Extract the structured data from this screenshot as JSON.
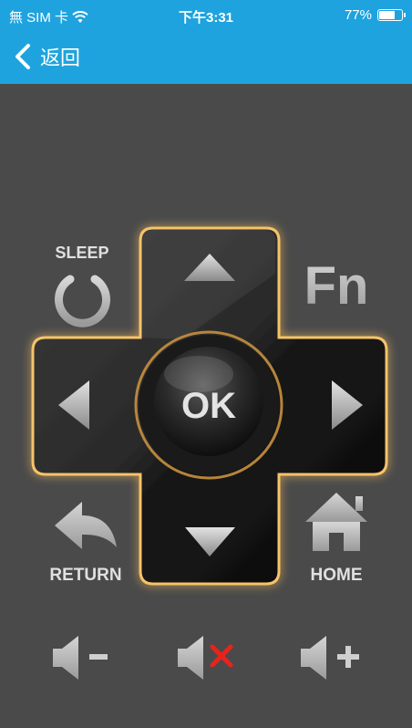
{
  "status_bar": {
    "carrier": "無 SIM 卡",
    "time": "下午3:31",
    "battery_text": "77%",
    "battery_level": 0.77
  },
  "nav": {
    "back_label": "返回"
  },
  "remote": {
    "sleep_label": "SLEEP",
    "fn_label": "Fn",
    "ok_label": "OK",
    "return_label": "RETURN",
    "home_label": "HOME"
  },
  "colors": {
    "nav_bar": "#1ea3de",
    "background": "#4a4a4a",
    "dpad_glow": "#f4b24a",
    "mute_x": "#e8231c"
  },
  "icons": [
    "wifi-icon",
    "battery-icon",
    "back-chevron-icon",
    "power-icon",
    "arrow-up-icon",
    "arrow-down-icon",
    "arrow-left-icon",
    "arrow-right-icon",
    "return-arrow-icon",
    "home-icon",
    "volume-down-icon",
    "mute-icon",
    "volume-up-icon"
  ]
}
